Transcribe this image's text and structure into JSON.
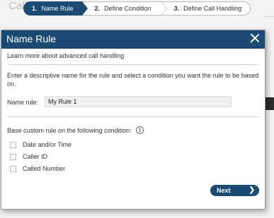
{
  "background": {
    "title_fragment": "Call /"
  },
  "wizard": {
    "steps": [
      {
        "number": "1.",
        "label": "Name Rule",
        "active": true
      },
      {
        "number": "2.",
        "label": "Define Condition",
        "active": false
      },
      {
        "number": "3.",
        "label": "Define Call Handling",
        "active": false
      }
    ]
  },
  "modal": {
    "title": "Name Rule",
    "close_icon": "close-icon",
    "learn_more": "Learn more about advanced call handling",
    "instructions": "Enter a descriptive name for the rule and select a condition you want the rule to be based on.",
    "rule_name_label": "Name rule:",
    "rule_name_value": "My Rule 1",
    "condition_label": "Base custom rule on the following condition:",
    "info_icon": "info-icon",
    "conditions": [
      {
        "label": "Date and/or Time",
        "checked": false
      },
      {
        "label": "Caller ID",
        "checked": false
      },
      {
        "label": "Called Number",
        "checked": false
      }
    ],
    "next_label": "Next",
    "next_icon": "chevron-right-icon"
  },
  "colors": {
    "header": "#1b4a72",
    "button": "#1b4a72"
  }
}
